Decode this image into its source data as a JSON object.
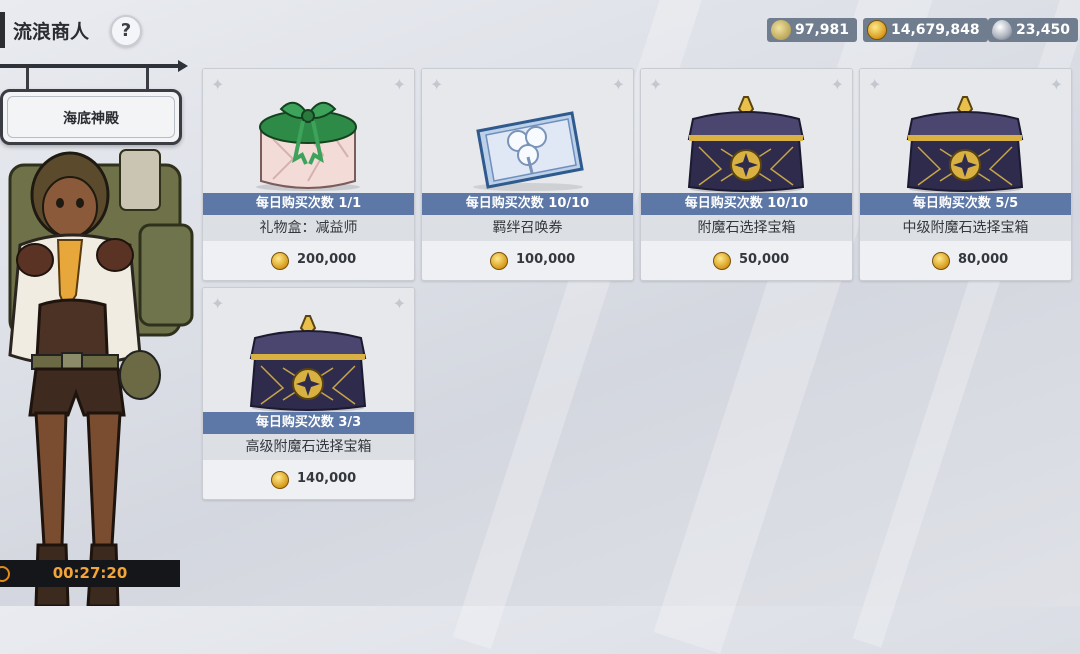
{
  "header": {
    "title": "流浪商人",
    "help_label": "?"
  },
  "currencies": [
    {
      "icon": "medal-icon",
      "value": "97,981"
    },
    {
      "icon": "gold-coin-icon",
      "value": "14,679,848"
    },
    {
      "icon": "water-drop-gem-icon",
      "value": "23,450"
    }
  ],
  "location": {
    "name": "海底神殿"
  },
  "timer": {
    "value": "00:27:20",
    "icon": "clock-icon"
  },
  "shop": {
    "items": [
      {
        "limit": "每日购买次数 1/1",
        "name": "礼物盒：减益师",
        "price": "200,000",
        "icon": "gift-box-icon"
      },
      {
        "limit": "每日购买次数 10/10",
        "name": "羁绊召唤券",
        "price": "100,000",
        "icon": "clover-ticket-icon"
      },
      {
        "limit": "每日购买次数 10/10",
        "name": "附魔石选择宝箱",
        "price": "50,000",
        "icon": "treasure-chest-icon"
      },
      {
        "limit": "每日购买次数 5/5",
        "name": "中级附魔石选择宝箱",
        "price": "80,000",
        "icon": "treasure-chest-icon"
      },
      {
        "limit": "每日购买次数 3/3",
        "name": "高级附魔石选择宝箱",
        "price": "140,000",
        "icon": "treasure-chest-icon"
      }
    ]
  },
  "colors": {
    "limit_bar": "#5d78a6",
    "currency_bg": "#6f7d8f",
    "timer_text": "#f2a53b"
  }
}
